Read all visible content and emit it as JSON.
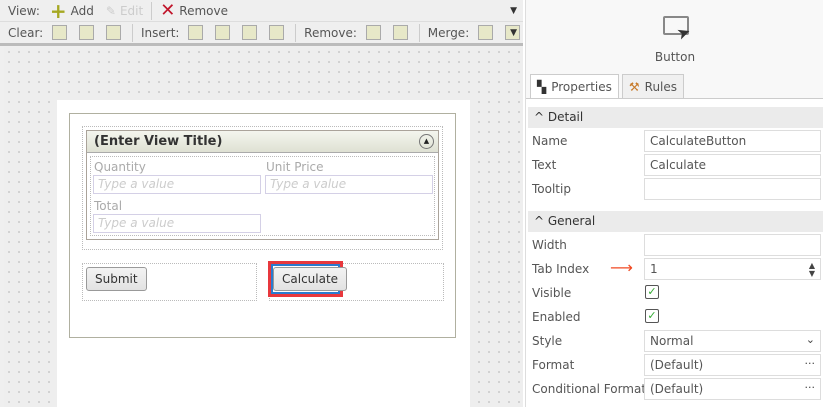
{
  "toolbar": {
    "view_label": "View:",
    "add": "Add",
    "edit": "Edit",
    "remove": "Remove",
    "clear_label": "Clear:",
    "insert_label": "Insert:",
    "remove_label": "Remove:",
    "merge_label": "Merge:"
  },
  "form": {
    "view_title": "(Enter View Title)",
    "fields": [
      {
        "label": "Quantity",
        "placeholder": "Type a value"
      },
      {
        "label": "Unit Price",
        "placeholder": "Type a value"
      },
      {
        "label": "Total",
        "placeholder": "Type a value"
      }
    ],
    "submit": "Submit",
    "calculate": "Calculate"
  },
  "panel": {
    "control_type": "Button",
    "tabs": [
      "Properties",
      "Rules"
    ],
    "detail": {
      "title": "Detail",
      "name_label": "Name",
      "name": "CalculateButton",
      "text_label": "Text",
      "text": "Calculate",
      "tooltip_label": "Tooltip",
      "tooltip": ""
    },
    "general": {
      "title": "General",
      "width_label": "Width",
      "width": "",
      "tabindex_label": "Tab Index",
      "tabindex": "1",
      "visible_label": "Visible",
      "visible": true,
      "enabled_label": "Enabled",
      "enabled": true,
      "style_label": "Style",
      "style": "Normal",
      "format_label": "Format",
      "format": "(Default)",
      "cond_label": "Conditional Format",
      "cond": "(Default)"
    }
  },
  "colors": {
    "highlight": "#e8383d",
    "selection": "#2a7bd0",
    "arrow": "#f04a23"
  }
}
